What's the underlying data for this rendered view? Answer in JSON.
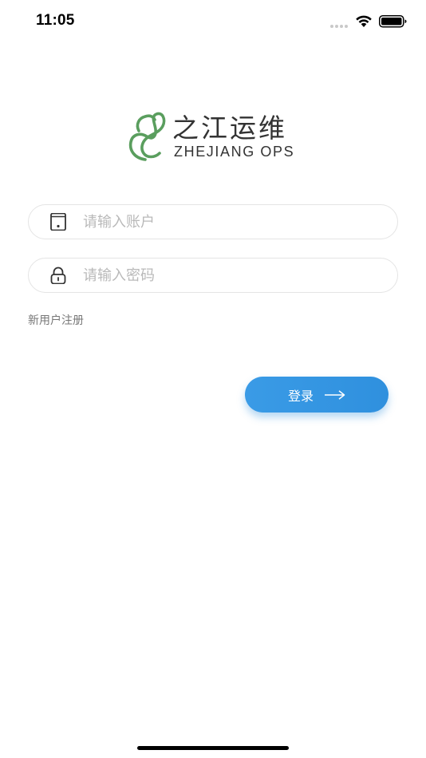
{
  "status_bar": {
    "time": "11:05",
    "icons": [
      "signal-icon",
      "wifi-icon",
      "battery-icon"
    ]
  },
  "logo": {
    "cn_name": "之江运维",
    "en_name": "ZHEJIANG OPS",
    "icon": "leaf-logo-icon",
    "brand_color": "#5a9e5e"
  },
  "login_form": {
    "account": {
      "placeholder": "请输入账户",
      "value": "",
      "icon": "phone-icon"
    },
    "password": {
      "placeholder": "请输入密码",
      "value": "",
      "icon": "lock-icon"
    },
    "register_link": "新用户注册",
    "login_button": {
      "label": "登录",
      "icon": "arrow-right-icon",
      "color": "#3398e3"
    }
  }
}
